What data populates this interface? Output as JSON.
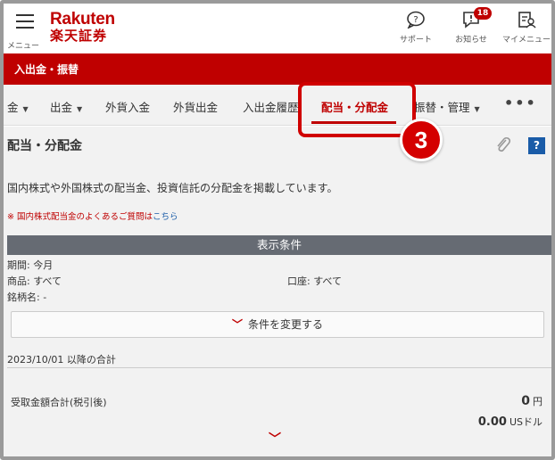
{
  "header": {
    "menu_label": "メニュー",
    "logo_en": "Rakuten",
    "logo_ja": "楽天証券",
    "support_label": "サポート",
    "notice_label": "お知らせ",
    "notice_count": "18",
    "mymenu_label": "マイメニュー"
  },
  "section_bar": {
    "title": "入出金・振替"
  },
  "tabs": [
    {
      "label": "金",
      "caret": "▼"
    },
    {
      "label": "出金",
      "caret": "▼"
    },
    {
      "label": "外貨入金"
    },
    {
      "label": "外貨出金"
    },
    {
      "label": "入出金履歴"
    },
    {
      "label": "配当・分配金",
      "active": true
    },
    {
      "label": "振替・管理",
      "caret": "▼"
    }
  ],
  "more_label": "•••",
  "step_number": "3",
  "page": {
    "title": "配当・分配金",
    "description": "国内株式や外国株式の配当金、投資信託の分配金を掲載しています。",
    "note_prefix": "※ 国内株式配当金のよくあるご質問は",
    "note_link": "こちら",
    "conditions_title": "表示条件",
    "period": "期間: 今月",
    "product": "商品: すべて",
    "account": "口座: すべて",
    "issue": "銘柄名: -",
    "change_button": "条件を変更する",
    "since_label": "2023/10/01 以降の合計",
    "received_label": "受取金額合計(税引後)",
    "received_jpy_value": "0",
    "received_jpy_unit": "円",
    "received_usd_value": "0.00",
    "received_usd_unit": "USドル"
  },
  "colors": {
    "brand_red": "#bf0000",
    "conditions_bar": "#666b73",
    "help_blue": "#1a5ca8"
  }
}
